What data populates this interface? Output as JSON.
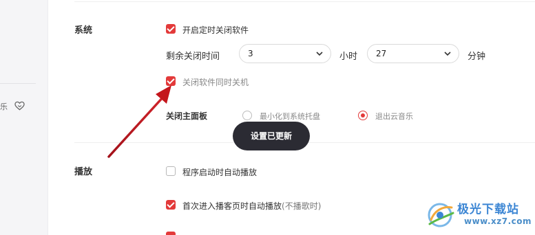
{
  "left_panel": {
    "snippet_text": "乐",
    "heart_icon": "heart-icon"
  },
  "system_section": {
    "title": "系统",
    "timer_close": {
      "label": "开启定时关闭软件",
      "checked": true
    },
    "remaining_time": {
      "label": "剩余关闭时间",
      "hours_value": "3",
      "hours_unit": "小时",
      "minutes_value": "27",
      "minutes_unit": "分钟"
    },
    "shutdown_with_app": {
      "label": "关闭软件同时关机",
      "checked": true
    },
    "close_main_panel": {
      "label": "关闭主面板",
      "options": [
        {
          "label": "最小化到系统托盘",
          "selected": false
        },
        {
          "label": "退出云音乐",
          "selected": true
        }
      ]
    }
  },
  "toast": {
    "text": "设置已更新"
  },
  "playback_section": {
    "title": "播放",
    "autoplay_on_start": {
      "label": "程序启动时自动播放",
      "checked": false
    },
    "autoplay_on_podcast": {
      "label": "首次进入播客页时自动播放",
      "suffix": "(不播歌时)",
      "checked": true
    }
  },
  "watermark": {
    "title": "极光下载站",
    "url": "www.xz7.com"
  },
  "colors": {
    "accent": "#e33a3a",
    "toast_bg": "#2b2b33",
    "annotation_arrow": "#c4161c",
    "watermark_blue": "#3c86d4"
  }
}
